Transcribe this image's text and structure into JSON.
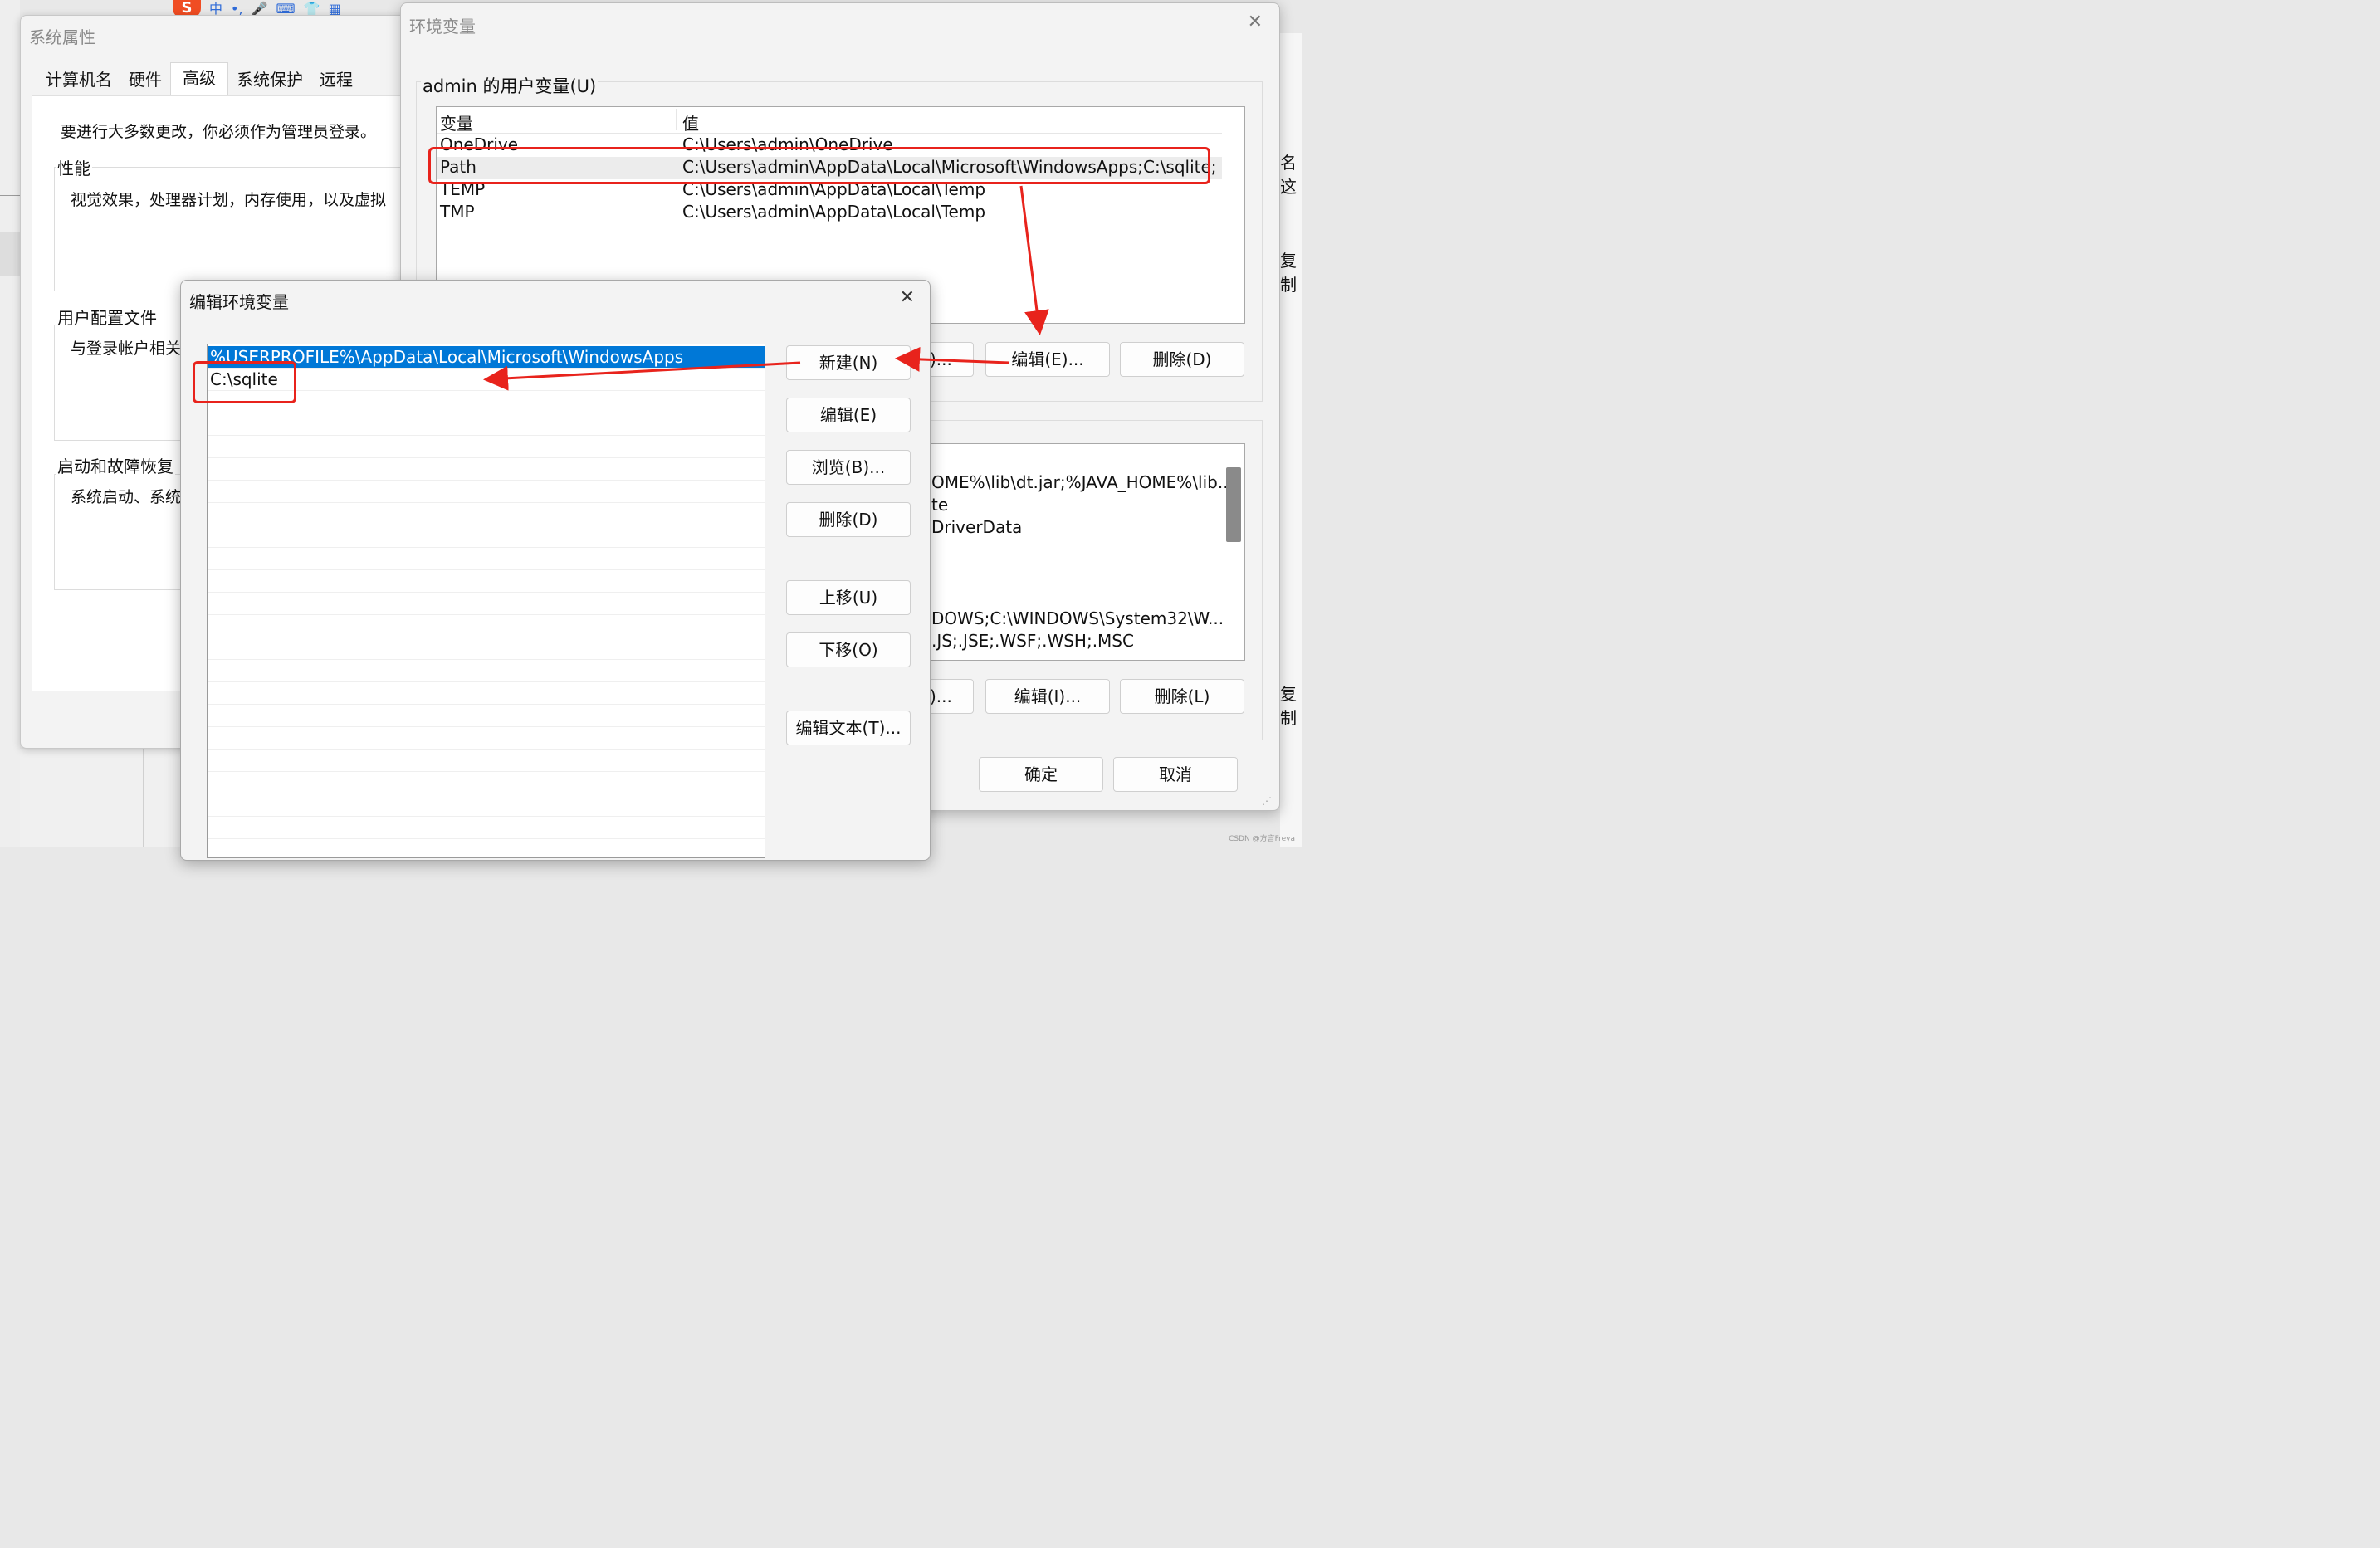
{
  "ime_toolbar": {
    "logo": "S",
    "items": [
      "中",
      "•,",
      "🎤",
      "⌨",
      "👕",
      "▦"
    ]
  },
  "system_properties": {
    "title": "系统属性",
    "tabs": [
      "计算机名",
      "硬件",
      "高级",
      "系统保护",
      "远程"
    ],
    "active_tab": "高级",
    "admin_notice": "要进行大多数更改，你必须作为管理员登录。",
    "performance": {
      "title": "性能",
      "text": "视觉效果，处理器计划，内存使用，以及虚拟"
    },
    "user_profiles": {
      "title": "用户配置文件",
      "text": "与登录帐户相关"
    },
    "startup": {
      "title": "启动和故障恢复",
      "text": "系统启动、系统"
    }
  },
  "environment_variables": {
    "title": "环境变量",
    "user_vars_title": "admin 的用户变量(U)",
    "columns": {
      "name": "变量",
      "value": "值"
    },
    "user_vars": [
      {
        "name": "OneDrive",
        "value": "C:\\Users\\admin\\OneDrive"
      },
      {
        "name": "Path",
        "value": "C:\\Users\\admin\\AppData\\Local\\Microsoft\\WindowsApps;C:\\sqlite;"
      },
      {
        "name": "TEMP",
        "value": "C:\\Users\\admin\\AppData\\Local\\Temp"
      },
      {
        "name": "TMP",
        "value": "C:\\Users\\admin\\AppData\\Local\\Temp"
      }
    ],
    "user_buttons": {
      "new_partial": ")...",
      "edit": "编辑(E)...",
      "delete": "删除(D)"
    },
    "system_vars_visible": [
      "OME%\\lib\\dt.jar;%JAVA_HOME%\\lib...",
      "te",
      "DriverData",
      "DOWS;C:\\WINDOWS\\System32\\W...",
      ".JS;.JSE;.WSF;.WSH;.MSC"
    ],
    "system_buttons": {
      "new_partial": ")...",
      "edit": "编辑(I)...",
      "delete": "删除(L)"
    },
    "ok": "确定",
    "cancel": "取消"
  },
  "edit_env_variable": {
    "title": "编辑环境变量",
    "entries": [
      "%USERPROFILE%\\AppData\\Local\\Microsoft\\WindowsApps",
      "C:\\sqlite"
    ],
    "buttons": {
      "new": "新建(N)",
      "edit": "编辑(E)",
      "browse": "浏览(B)...",
      "delete": "删除(D)",
      "move_up": "上移(U)",
      "move_down": "下移(O)",
      "edit_text": "编辑文本(T)..."
    }
  },
  "right_edge_fragments": [
    "名这",
    "复制",
    "复制"
  ],
  "annotation_color": "#e8231c",
  "selection_color": "#0078d7",
  "watermark": "CSDN @方言Freya"
}
